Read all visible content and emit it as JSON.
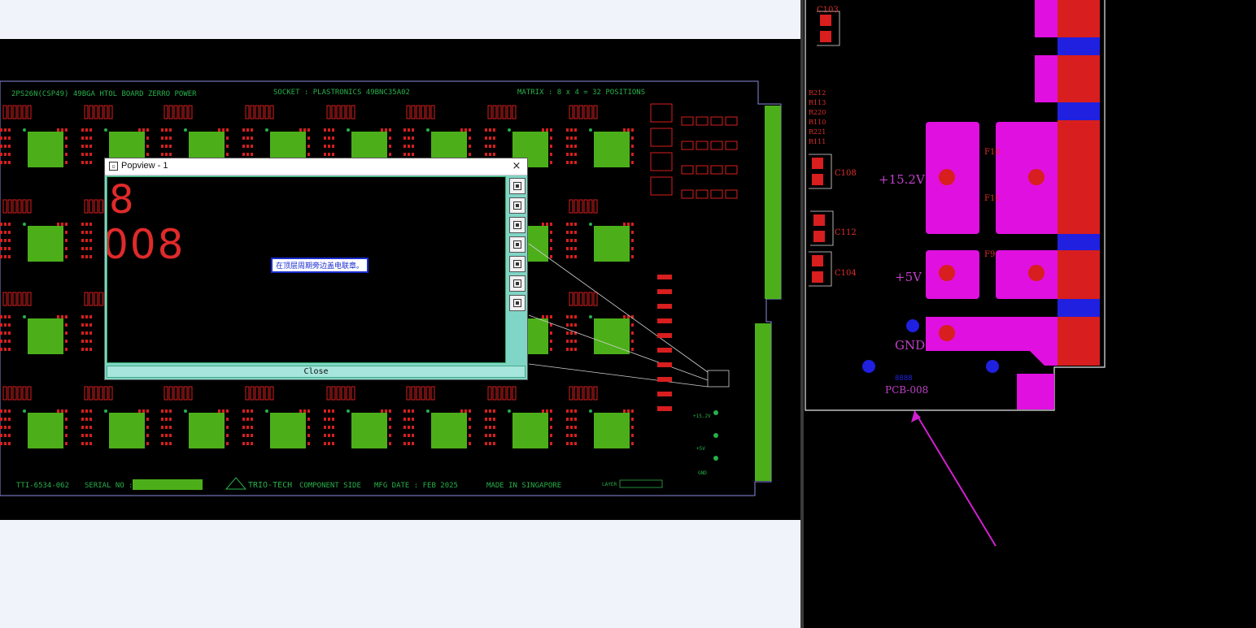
{
  "board": {
    "header_left": "2PS26N(CSP49) 49BGA HTOL BOARD   ZERRO POWER",
    "header_mid": "SOCKET : PLASTRONICS 49BNC35A02",
    "header_right": "MATRIX : 8 x 4 = 32 POSITIONS",
    "footer_part": "TTI-6534-062",
    "footer_serial": "SERIAL NO :",
    "footer_logo": "TRIO-TECH",
    "footer_component": "COMPONENT SIDE",
    "footer_date": "MFG DATE : FEB 2025",
    "footer_made": "MADE IN SINGAPORE",
    "footer_layer": "LAYER",
    "rail_15v": "+15.2V",
    "rail_5v": "+5V",
    "rail_gnd": "GND"
  },
  "popview": {
    "title": "Popview - 1",
    "close_x": "×",
    "big_digit": "8",
    "big_number": "008",
    "tooltip": "在顶层周期旁边盖电联章。",
    "close_label": "Close"
  },
  "detail": {
    "caps": [
      "C103",
      "C108",
      "C112",
      "C104"
    ],
    "resistors": [
      "R212",
      "R113",
      "R220",
      "R110",
      "R221",
      "R111"
    ],
    "fuses": [
      "F10",
      "F11",
      "F9"
    ],
    "rail_15v": "+15.2V",
    "rail_5v": "+5V",
    "rail_gnd": "GND",
    "pcb_label": "PCB-008",
    "hash_label": "8888"
  },
  "colors": {
    "board_bg": "#000000",
    "pad_red": "#d81e1e",
    "socket_green": "#4caf1a",
    "copper_magenta": "#e010e0",
    "plane_blue": "#2020e0",
    "silk_green": "#27b04a",
    "arrow_magenta": "#d020d0"
  }
}
